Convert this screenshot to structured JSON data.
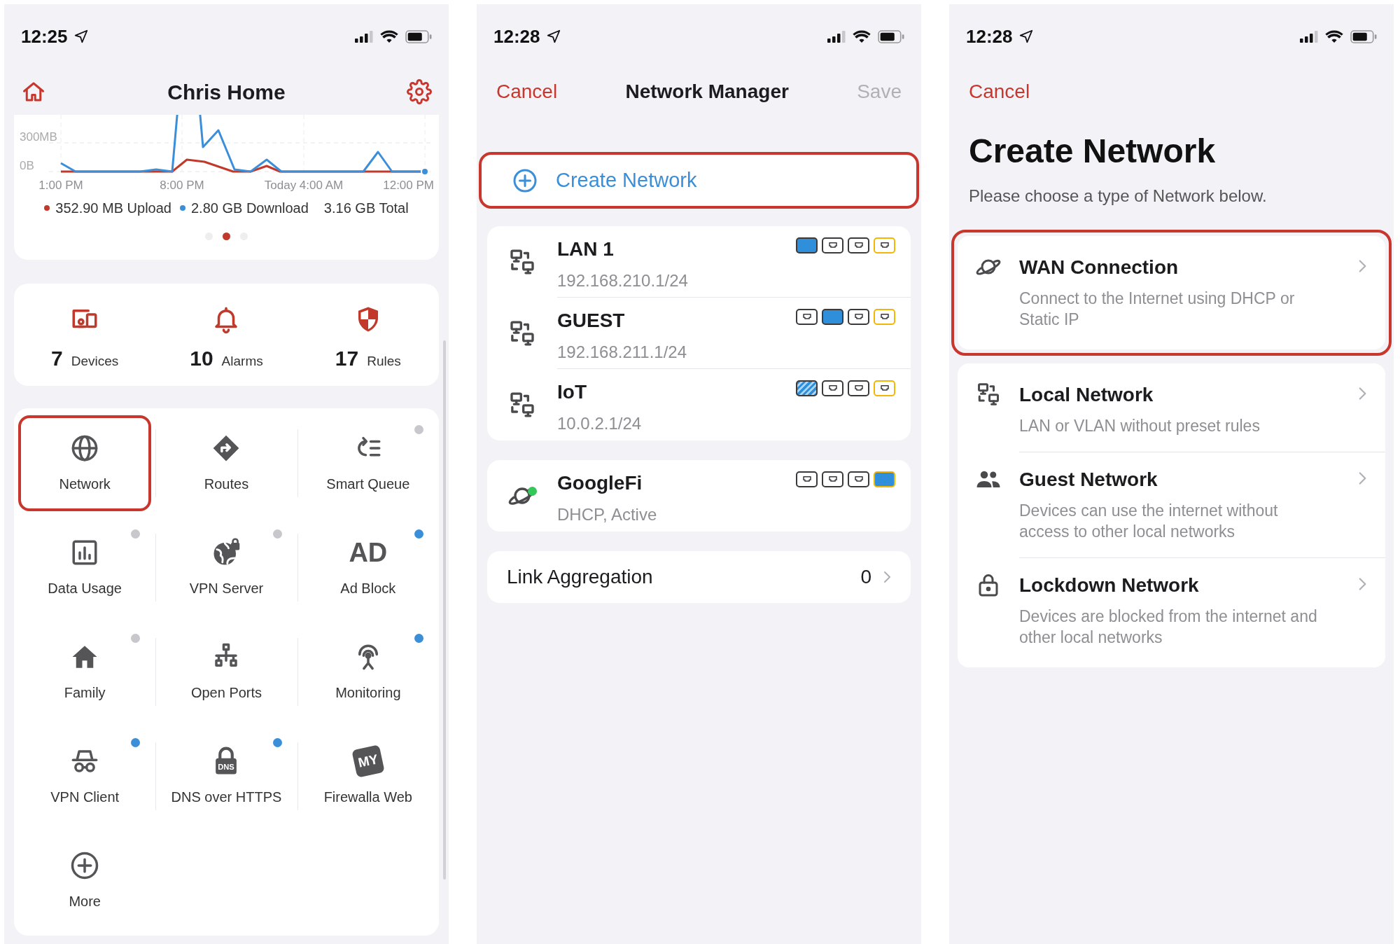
{
  "home_screen": {
    "status_bar": {
      "time": "12:25"
    },
    "header": {
      "title": "Chris Home"
    },
    "usage_card": {
      "chart": {
        "y_labels": [
          "300MB",
          "0B"
        ],
        "x_labels": [
          "1:00 PM",
          "8:00 PM",
          "Today 4:00 AM",
          "12:00 PM"
        ]
      },
      "legend": [
        {
          "text": "352.90 MB Upload",
          "color": "#c0392b"
        },
        {
          "text": "2.80 GB Download",
          "color": "#3b8fd9"
        }
      ],
      "total": "3.16 GB Total",
      "pages": [
        {
          "selected": false
        },
        {
          "selected": true
        },
        {
          "selected": false
        }
      ]
    },
    "stats": [
      {
        "kind": "devices",
        "count": "7",
        "label": "Devices"
      },
      {
        "kind": "bell",
        "count": "10",
        "label": "Alarms"
      },
      {
        "kind": "shield",
        "count": "17",
        "label": "Rules"
      }
    ],
    "tiles": [
      {
        "kind": "globe",
        "label": "Network",
        "highlighted": true
      },
      {
        "kind": "routes",
        "label": "Routes",
        "highlighted": false
      },
      {
        "kind": "queue",
        "label": "Smart Queue",
        "highlighted": false,
        "color": "#c7c7cc"
      },
      {
        "kind": "chart",
        "label": "Data Usage",
        "highlighted": false,
        "color": "#c7c7cc"
      },
      {
        "kind": "vpnserver",
        "label": "VPN Server",
        "highlighted": false,
        "color": "#c7c7cc"
      },
      {
        "kind": "letters",
        "icon_text": "AD",
        "label": "Ad Block",
        "highlighted": false,
        "color": "#3b8fd9"
      },
      {
        "kind": "house",
        "label": "Family",
        "highlighted": false,
        "color": "#c7c7cc"
      },
      {
        "kind": "ports",
        "label": "Open Ports",
        "highlighted": false
      },
      {
        "kind": "antenna",
        "label": "Monitoring",
        "highlighted": false,
        "color": "#3b8fd9"
      },
      {
        "kind": "incognito",
        "label": "VPN Client",
        "highlighted": false,
        "color": "#3b8fd9"
      },
      {
        "kind": "dnslock",
        "icon_text": "DNS",
        "label": "DNS over HTTPS",
        "highlighted": false,
        "color": "#3b8fd9"
      },
      {
        "kind": "tag",
        "icon_text": "MY",
        "label": "Firewalla Web",
        "highlighted": false
      },
      {
        "kind": "plus",
        "label": "More",
        "highlighted": false
      }
    ]
  },
  "network_manager": {
    "status_bar": {
      "time": "12:28"
    },
    "header": {
      "cancel": "Cancel",
      "title": "Network Manager",
      "save": "Save",
      "save_disabled": true
    },
    "create_button": {
      "label": "Create Network",
      "highlighted": true
    },
    "network_groups": [
      {
        "items": [
          {
            "kind": "lan",
            "name": "LAN 1",
            "detail": "192.168.210.1/24",
            "online": false,
            "ports": [
              {
                "kind": "assigned",
                "wan": false
              },
              {
                "kind": "free",
                "wan": false
              },
              {
                "kind": "free",
                "wan": false
              },
              {
                "kind": "free",
                "wan": true
              }
            ]
          },
          {
            "kind": "lan",
            "name": "GUEST",
            "detail": "192.168.211.1/24",
            "online": false,
            "ports": [
              {
                "kind": "free",
                "wan": false
              },
              {
                "kind": "assigned",
                "wan": false
              },
              {
                "kind": "free",
                "wan": false
              },
              {
                "kind": "free",
                "wan": true
              }
            ]
          },
          {
            "kind": "lan",
            "name": "IoT",
            "detail": "10.0.2.1/24",
            "online": false,
            "ports": [
              {
                "kind": "shared",
                "wan": false
              },
              {
                "kind": "free",
                "wan": false
              },
              {
                "kind": "free",
                "wan": false
              },
              {
                "kind": "free",
                "wan": true
              }
            ]
          }
        ]
      },
      {
        "items": [
          {
            "kind": "planet",
            "name": "GoogleFi",
            "detail": "DHCP, Active",
            "online": true,
            "ports": [
              {
                "kind": "free",
                "wan": false
              },
              {
                "kind": "free",
                "wan": false
              },
              {
                "kind": "free",
                "wan": false
              },
              {
                "kind": "assigned",
                "wan": true
              }
            ]
          }
        ]
      }
    ],
    "link_aggregation": {
      "label": "Link Aggregation",
      "count": "0"
    }
  },
  "create_network": {
    "status_bar": {
      "time": "12:28"
    },
    "header": {
      "cancel": "Cancel"
    },
    "title": "Create Network",
    "subtitle": "Please choose a type of Network below.",
    "option_groups": [
      {
        "highlighted": true,
        "items": [
          {
            "kind": "planet",
            "title": "WAN Connection",
            "description": "Connect to the Internet using DHCP or Static IP"
          }
        ]
      },
      {
        "highlighted": false,
        "items": [
          {
            "kind": "lan",
            "title": "Local Network",
            "description": "LAN or VLAN without preset rules"
          },
          {
            "kind": "people",
            "title": "Guest Network",
            "description": "Devices can use the internet without access to other local networks"
          },
          {
            "kind": "lock",
            "title": "Lockdown Network",
            "description": "Devices are blocked from the internet and other local networks"
          }
        ]
      }
    ]
  }
}
